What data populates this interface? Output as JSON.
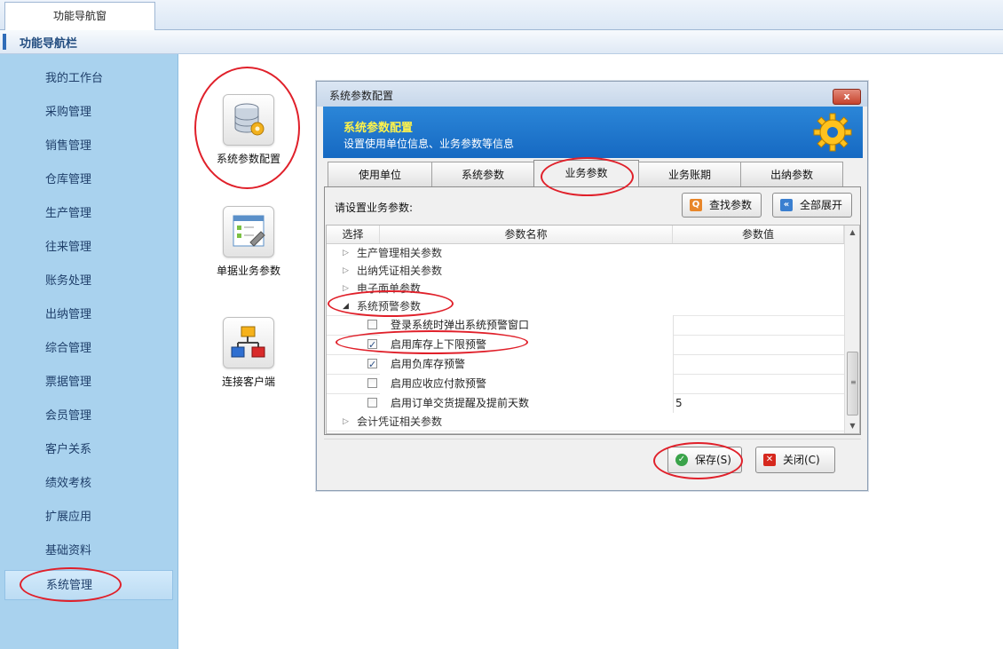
{
  "top_tab": {
    "label": "功能导航窗"
  },
  "navbar": {
    "title": "功能导航栏"
  },
  "sidebar": {
    "items": [
      {
        "label": "我的工作台"
      },
      {
        "label": "采购管理"
      },
      {
        "label": "销售管理"
      },
      {
        "label": "仓库管理"
      },
      {
        "label": "生产管理"
      },
      {
        "label": "往来管理"
      },
      {
        "label": "账务处理"
      },
      {
        "label": "出纳管理"
      },
      {
        "label": "综合管理"
      },
      {
        "label": "票据管理"
      },
      {
        "label": "会员管理"
      },
      {
        "label": "客户关系"
      },
      {
        "label": "绩效考核"
      },
      {
        "label": "扩展应用"
      },
      {
        "label": "基础资料"
      },
      {
        "label": "系统管理"
      }
    ],
    "active": "系统管理"
  },
  "launchers": [
    {
      "label": "系统参数配置",
      "icon": "database-gear-icon"
    },
    {
      "label": "单据业务参数",
      "icon": "form-settings-icon"
    },
    {
      "label": "连接客户端",
      "icon": "network-topology-icon"
    }
  ],
  "dialog": {
    "title": "系统参数配置",
    "close_label": "x",
    "banner": {
      "title": "系统参数配置",
      "subtitle": "设置使用单位信息、业务参数等信息"
    },
    "tabs": [
      {
        "label": "使用单位"
      },
      {
        "label": "系统参数"
      },
      {
        "label": "业务参数"
      },
      {
        "label": "业务账期"
      },
      {
        "label": "出纳参数"
      }
    ],
    "active_tab": "业务参数",
    "prompt": "请设置业务参数:",
    "find_button": "查找参数",
    "expand_button": "全部展开",
    "grid": {
      "columns": [
        "选择",
        "参数名称",
        "参数值"
      ],
      "groups_before": [
        "生产管理相关参数",
        "出纳凭证相关参数",
        "电子面单参数"
      ],
      "expanded_group": "系统预警参数",
      "rows": [
        {
          "checked": false,
          "name": "登录系统时弹出系统预警窗口",
          "value": ""
        },
        {
          "checked": true,
          "name": "启用库存上下限预警",
          "value": ""
        },
        {
          "checked": true,
          "name": "启用负库存预警",
          "value": ""
        },
        {
          "checked": false,
          "name": "启用应收应付款预警",
          "value": ""
        },
        {
          "checked": false,
          "name": "启用订单交货提醒及提前天数",
          "value": "5"
        }
      ],
      "groups_after": [
        "会计凭证相关参数"
      ]
    },
    "save_button": "保存(S)",
    "close_button": "关闭(C)"
  },
  "colors": {
    "annotation": "#e0202a",
    "banner": "#1f78cf",
    "sidebar": "#a9d2ee"
  }
}
